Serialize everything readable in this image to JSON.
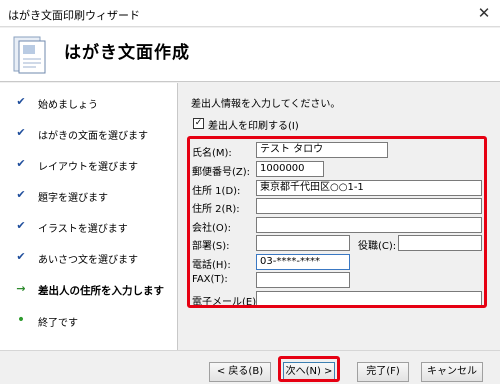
{
  "window": {
    "title": "はがき文面印刷ウィザード",
    "close_label": "✕"
  },
  "header": {
    "title": "はがき文面作成"
  },
  "steps": [
    {
      "label": "始めましょう",
      "state": "done"
    },
    {
      "label": "はがきの文面を選びます",
      "state": "done"
    },
    {
      "label": "レイアウトを選びます",
      "state": "done"
    },
    {
      "label": "題字を選びます",
      "state": "done"
    },
    {
      "label": "イラストを選びます",
      "state": "done"
    },
    {
      "label": "あいさつ文を選びます",
      "state": "done"
    },
    {
      "label": "差出人の住所を入力します",
      "state": "current"
    },
    {
      "label": "終了です",
      "state": "pending"
    }
  ],
  "step_marks": {
    "done": "✔",
    "current": "→",
    "pending": "•"
  },
  "main": {
    "instruction": "差出人情報を入力してください。",
    "print_sender_label": "差出人を印刷する(I)",
    "print_sender_checked": "✓",
    "fields": {
      "name_label": "氏名(M):",
      "name_value": "テスト タロウ",
      "zip_label": "郵便番号(Z):",
      "zip_value": "1000000",
      "addr1_label": "住所 1(D):",
      "addr1_value": "東京都千代田区○○1-1",
      "addr2_label": "住所 2(R):",
      "addr2_value": "",
      "company_label": "会社(O):",
      "company_value": "",
      "dept_label": "部署(S):",
      "dept_value": "",
      "title_label": "役職(C):",
      "title_value": "",
      "phone_label": "電話(H):",
      "phone_value": "03-****-****",
      "fax_label": "FAX(T):",
      "fax_value": "",
      "email_label": "電子メール(E):",
      "email_value": ""
    }
  },
  "footer": {
    "back_label": "< 戻る(B)",
    "next_label": "次へ(N) >",
    "finish_label": "完了(F)",
    "cancel_label": "キャンセル"
  },
  "colors": {
    "highlight": "#e60012",
    "accent": "#3a78c3"
  }
}
